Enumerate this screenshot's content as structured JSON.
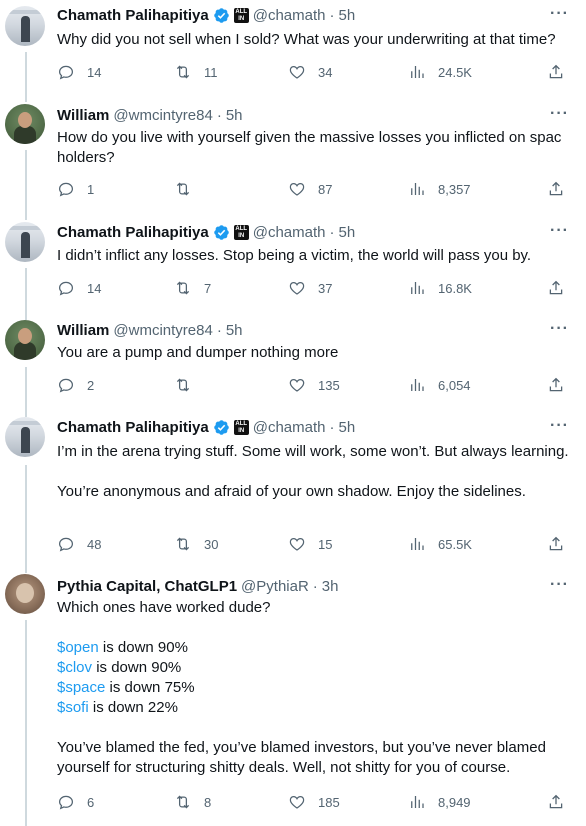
{
  "tweets": [
    {
      "name": "Chamath Palihapitiya",
      "handle": "@chamath",
      "time": "5h",
      "badge": "ALL IN",
      "paragraphs": [
        "Why did you not sell when I sold? What was your underwriting at that time?"
      ],
      "stats": {
        "replies": "14",
        "retweets": "11",
        "likes": "34",
        "views": "24.5K"
      }
    },
    {
      "name": "William",
      "handle": "@wmcintyre84",
      "time": "5h",
      "paragraphs": [
        "How do you live with yourself given the massive losses you inflicted on spac holders?"
      ],
      "stats": {
        "replies": "1",
        "retweets": "",
        "likes": "87",
        "views": "8,357"
      }
    },
    {
      "name": "Chamath Palihapitiya",
      "handle": "@chamath",
      "time": "5h",
      "badge": "ALL IN",
      "paragraphs": [
        "I didn’t inflict any losses. Stop being a victim, the world will pass you by."
      ],
      "stats": {
        "replies": "14",
        "retweets": "7",
        "likes": "37",
        "views": "16.8K"
      }
    },
    {
      "name": "William",
      "handle": "@wmcintyre84",
      "time": "5h",
      "paragraphs": [
        "You are a pump and dumper nothing more"
      ],
      "stats": {
        "replies": "2",
        "retweets": "",
        "likes": "135",
        "views": "6,054"
      }
    },
    {
      "name": "Chamath Palihapitiya",
      "handle": "@chamath",
      "time": "5h",
      "badge": "ALL IN",
      "paragraphs": [
        "I’m in the arena trying stuff. Some will work, some won’t. But always learning.",
        "You’re anonymous and afraid of your own shadow. Enjoy the sidelines."
      ],
      "stats": {
        "replies": "48",
        "retweets": "30",
        "likes": "15",
        "views": "65.5K"
      }
    },
    {
      "name": "Pythia Capital, ChatGLP1",
      "handle": "@PythiaR",
      "time": "3h",
      "intro": "Which ones have worked dude?",
      "cashtags": [
        {
          "tag": "$open",
          "text": " is down 90%"
        },
        {
          "tag": "$clov",
          "text": " is down 90%"
        },
        {
          "tag": "$space",
          "text": " is down 75%"
        },
        {
          "tag": "$sofi",
          "text": " is down 22%"
        }
      ],
      "outro": "You’ve blamed the fed, you’ve blamed investors, but you’ve never blamed yourself for structuring shitty deals. Well, not shitty for you of course.",
      "stats": {
        "replies": "6",
        "retweets": "8",
        "likes": "185",
        "views": "8,949"
      }
    }
  ],
  "more_glyph": "···",
  "colors": {
    "link": "#1d9bf0",
    "verified": "#1d9bf0",
    "muted": "#536471",
    "thread_line": "#cfd9de"
  }
}
